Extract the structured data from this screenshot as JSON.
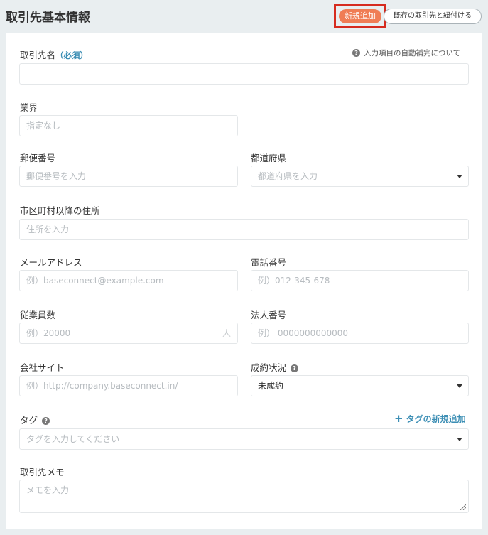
{
  "header": {
    "title": "取引先基本情報",
    "new_button": "新規追加",
    "link_button": "既存の取引先と紐付ける"
  },
  "form": {
    "autocomplete_note": "入力項目の自動補完について",
    "name": {
      "label": "取引先名",
      "required": "（必須）",
      "placeholder": ""
    },
    "industry": {
      "label": "業界",
      "placeholder": "指定なし"
    },
    "postal": {
      "label": "郵便番号",
      "placeholder": "郵便番号を入力"
    },
    "prefecture": {
      "label": "都道府県",
      "placeholder": "都道府県を入力"
    },
    "address": {
      "label": "市区町村以降の住所",
      "placeholder": "住所を入力"
    },
    "email": {
      "label": "メールアドレス",
      "placeholder": "例）baseconnect@example.com"
    },
    "phone": {
      "label": "電話番号",
      "placeholder": "例）012-345-678"
    },
    "employees": {
      "label": "従業員数",
      "placeholder": "例）20000",
      "unit": "人"
    },
    "corporate_number": {
      "label": "法人番号",
      "placeholder": "例） 0000000000000"
    },
    "website": {
      "label": "会社サイト",
      "placeholder": "例）http://company.baseconnect.in/"
    },
    "deal_status": {
      "label": "成約状況",
      "value": "未成約"
    },
    "tags": {
      "label": "タグ",
      "placeholder": "タグを入力してください",
      "add_label": "タグの新規追加"
    },
    "memo": {
      "label": "取引先メモ",
      "placeholder": "メモを入力"
    }
  },
  "colors": {
    "accent": "#f07d55",
    "link": "#3d8fb5",
    "highlight": "#d62b1f"
  }
}
